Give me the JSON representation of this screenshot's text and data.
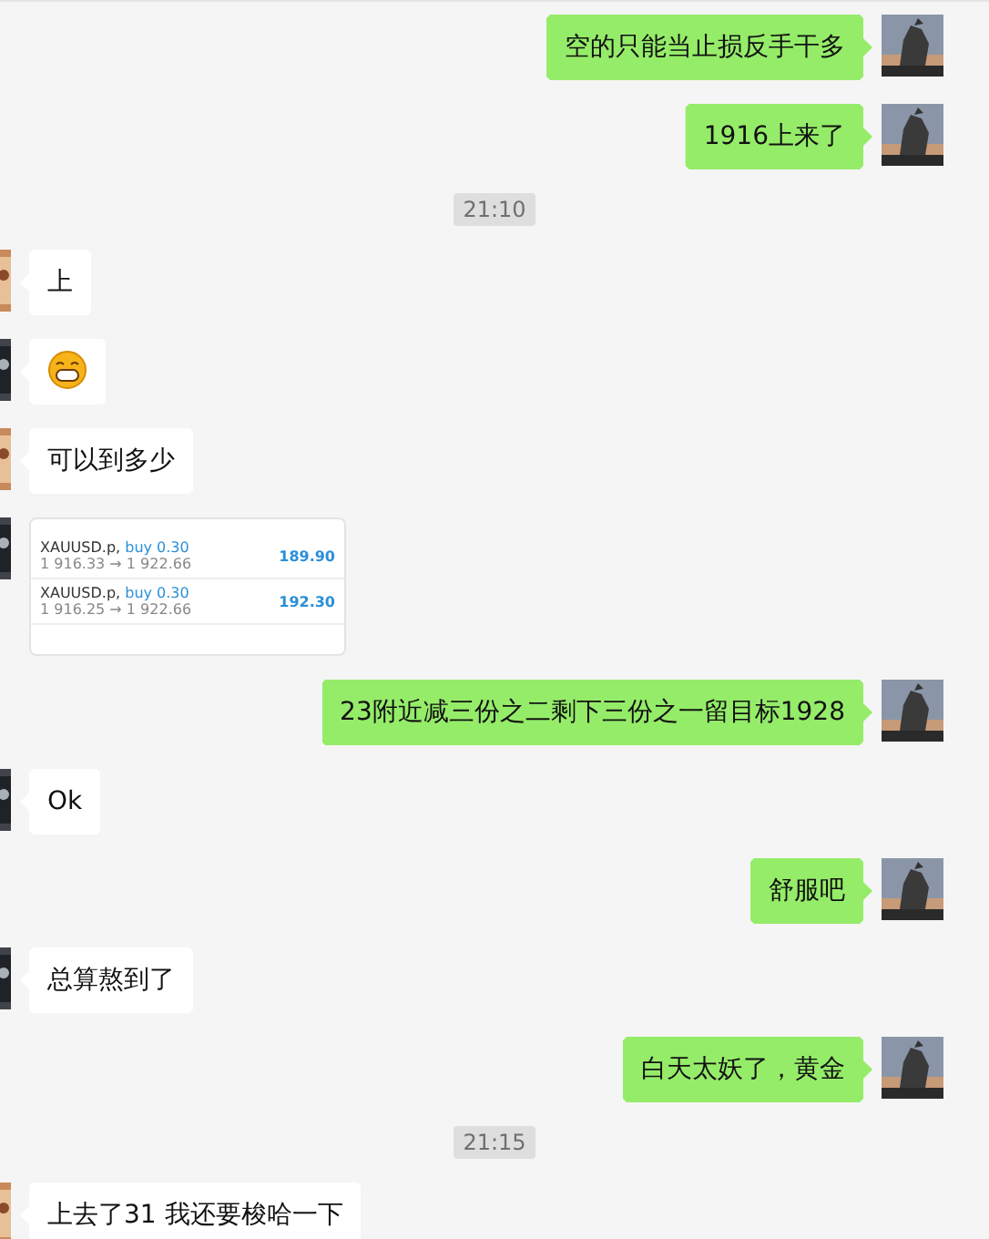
{
  "messages": [
    {
      "kind": "text",
      "outgoing": true,
      "text": "空的只能当止损反手干多"
    },
    {
      "kind": "text",
      "outgoing": true,
      "text": "1916上来了"
    },
    {
      "kind": "time",
      "text": "21:10"
    },
    {
      "kind": "text",
      "outgoing": false,
      "text": "上"
    },
    {
      "kind": "emoji",
      "outgoing": false
    },
    {
      "kind": "text",
      "outgoing": false,
      "text": "可以到多少"
    },
    {
      "kind": "trade",
      "outgoing": false,
      "rows": [
        {
          "symbol": "XAUUSD.p,",
          "side": "buy 0.30",
          "prices": "1 916.33 → 1 922.66",
          "profit": "189.90"
        },
        {
          "symbol": "XAUUSD.p,",
          "side": "buy 0.30",
          "prices": "1 916.25 → 1 922.66",
          "profit": "192.30"
        }
      ]
    },
    {
      "kind": "text",
      "outgoing": true,
      "text": "23附近减三份之二剩下三份之一留目标1928"
    },
    {
      "kind": "text",
      "outgoing": false,
      "text": "Ok"
    },
    {
      "kind": "text",
      "outgoing": true,
      "text": "舒服吧"
    },
    {
      "kind": "text",
      "outgoing": false,
      "text": "总算熬到了"
    },
    {
      "kind": "text",
      "outgoing": true,
      "text": "白天太妖了，黄金"
    },
    {
      "kind": "time",
      "text": "21:15"
    },
    {
      "kind": "text",
      "outgoing": false,
      "text": "上去了31 我还要梭哈一下"
    }
  ]
}
